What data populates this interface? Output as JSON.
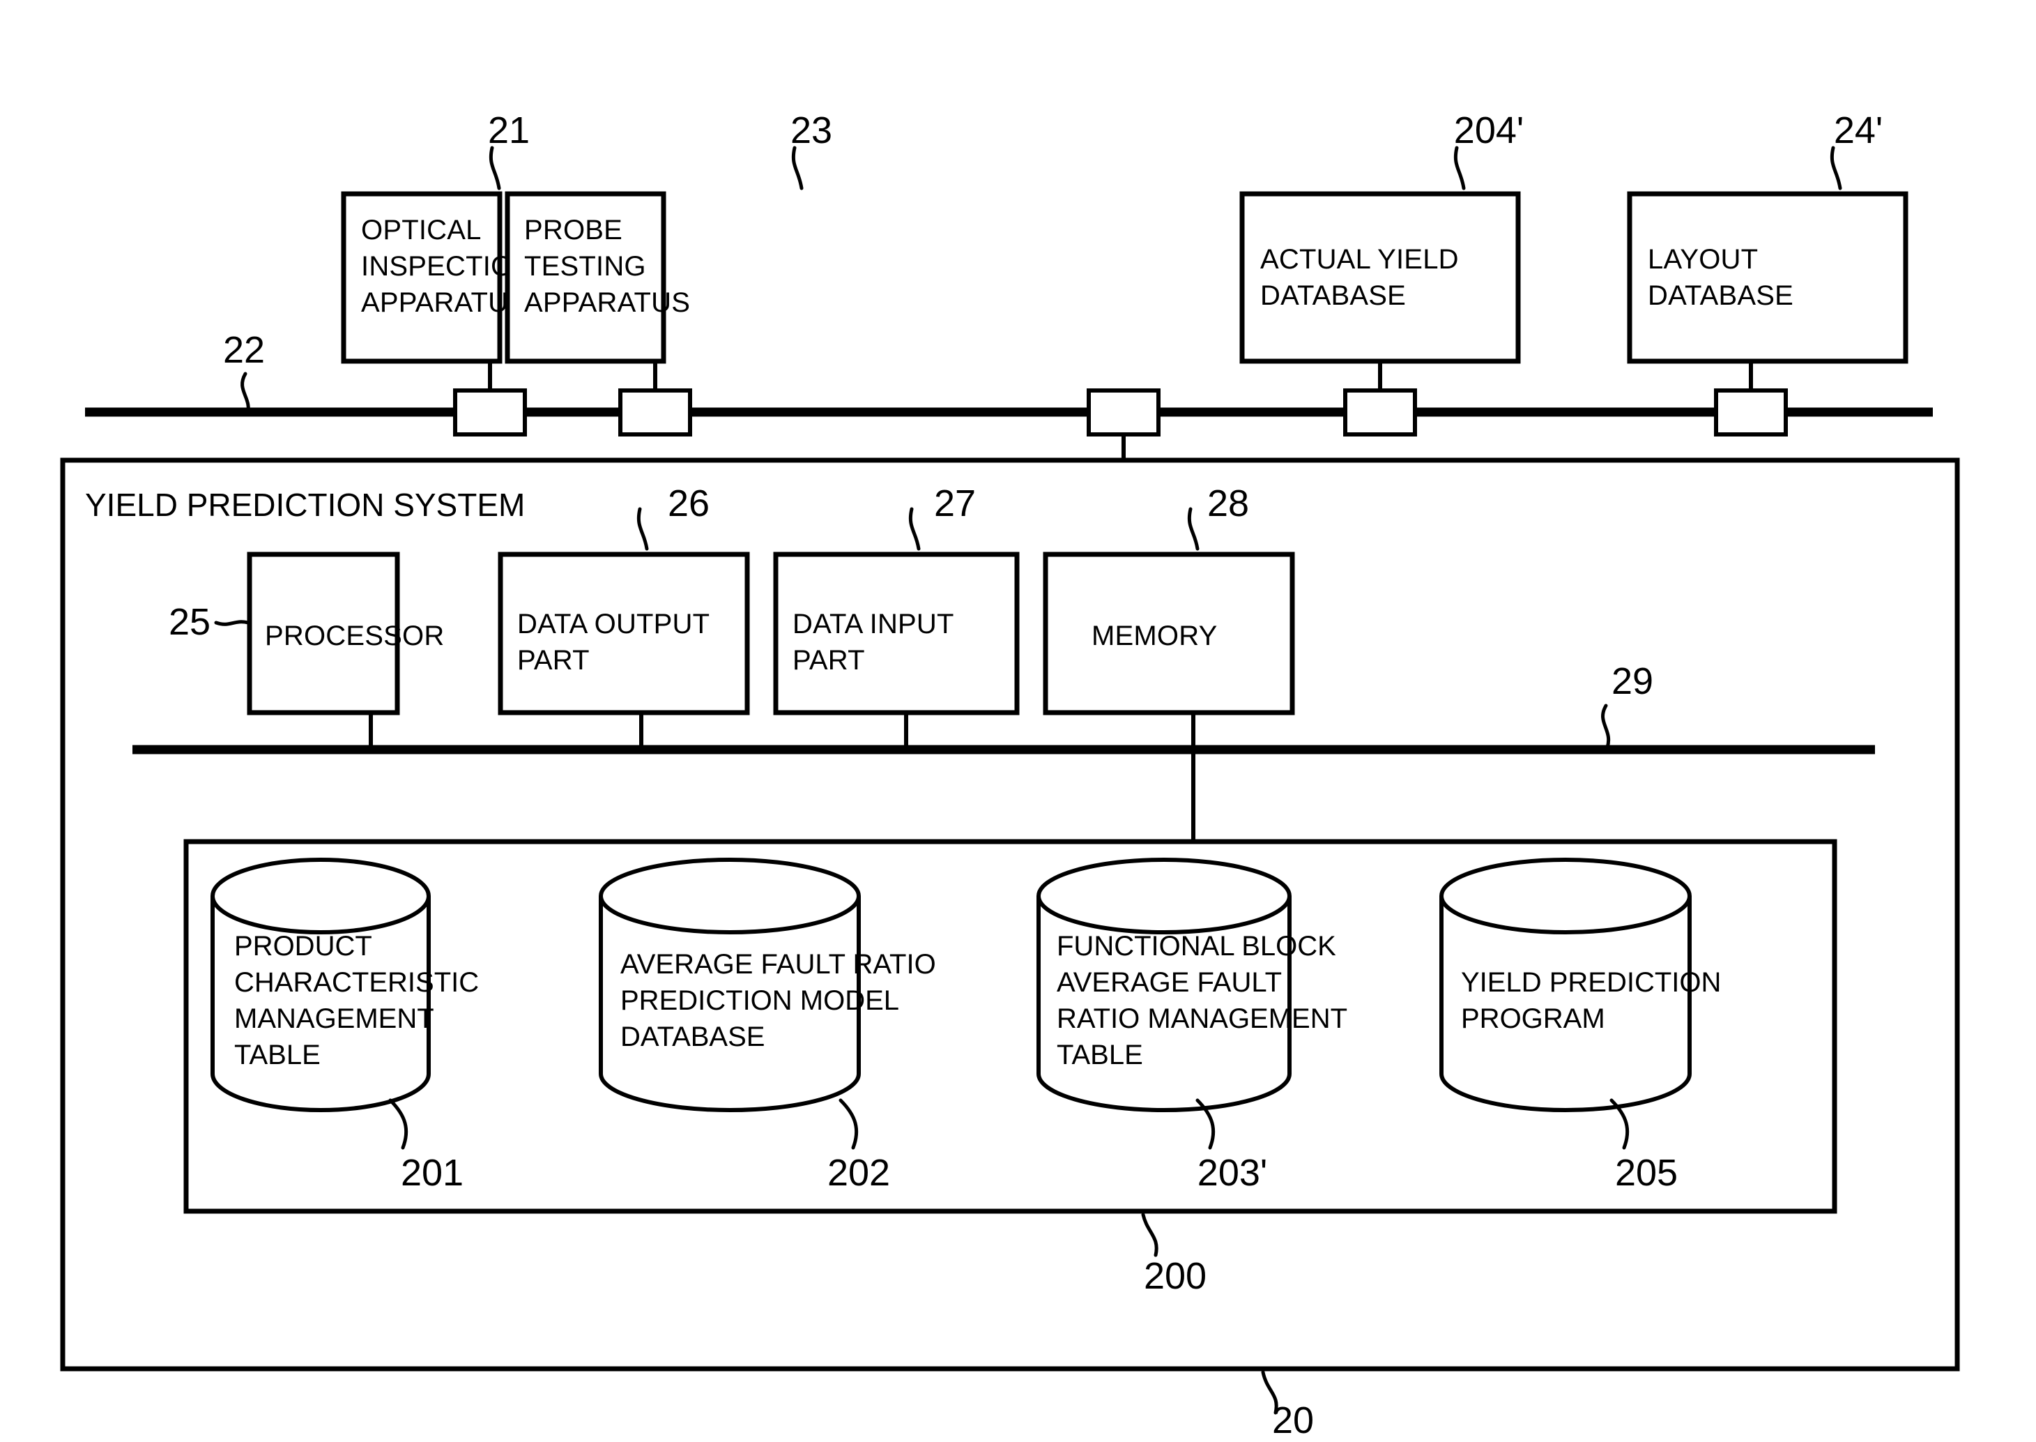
{
  "figure": {
    "title_text": "YIELD PREDICTION SYSTEM",
    "outer_ref": "20",
    "storage_container_ref": "200"
  },
  "external_bus": {
    "ref": "22"
  },
  "internal_bus": {
    "ref": "29"
  },
  "top_units": [
    {
      "label_line1": "OPTICAL",
      "label_line2": "INSPECTION",
      "label_line3": "APPARATUS",
      "ref": "21"
    },
    {
      "label_line1": "PROBE",
      "label_line2": "TESTING",
      "label_line3": "APPARATUS",
      "ref": "23"
    },
    {
      "label_line1": "ACTUAL YIELD",
      "label_line2": "DATABASE",
      "label_line3": "",
      "ref": "204'"
    },
    {
      "label_line1": "LAYOUT",
      "label_line2": "DATABASE",
      "label_line3": "",
      "ref": "24'"
    }
  ],
  "system_units": [
    {
      "label_line1": "PROCESSOR",
      "label_line2": "",
      "ref": "25"
    },
    {
      "label_line1": "DATA OUTPUT",
      "label_line2": "PART",
      "ref": "26"
    },
    {
      "label_line1": "DATA INPUT",
      "label_line2": "PART",
      "ref": "27"
    },
    {
      "label_line1": "MEMORY",
      "label_line2": "",
      "ref": "28"
    }
  ],
  "storage_units": [
    {
      "ref": "201",
      "lines": [
        "PRODUCT",
        "CHARACTERISTIC",
        "MANAGEMENT",
        "TABLE"
      ]
    },
    {
      "ref": "202",
      "lines": [
        "AVERAGE FAULT RATIO",
        "PREDICTION MODEL",
        "DATABASE"
      ]
    },
    {
      "ref": "203'",
      "lines": [
        "FUNCTIONAL BLOCK",
        "AVERAGE FAULT",
        "RATIO MANAGEMENT",
        "TABLE"
      ]
    },
    {
      "ref": "205",
      "lines": [
        "YIELD PREDICTION",
        "PROGRAM"
      ]
    }
  ],
  "colors": {
    "ink": "#000000",
    "paper": "#ffffff"
  }
}
